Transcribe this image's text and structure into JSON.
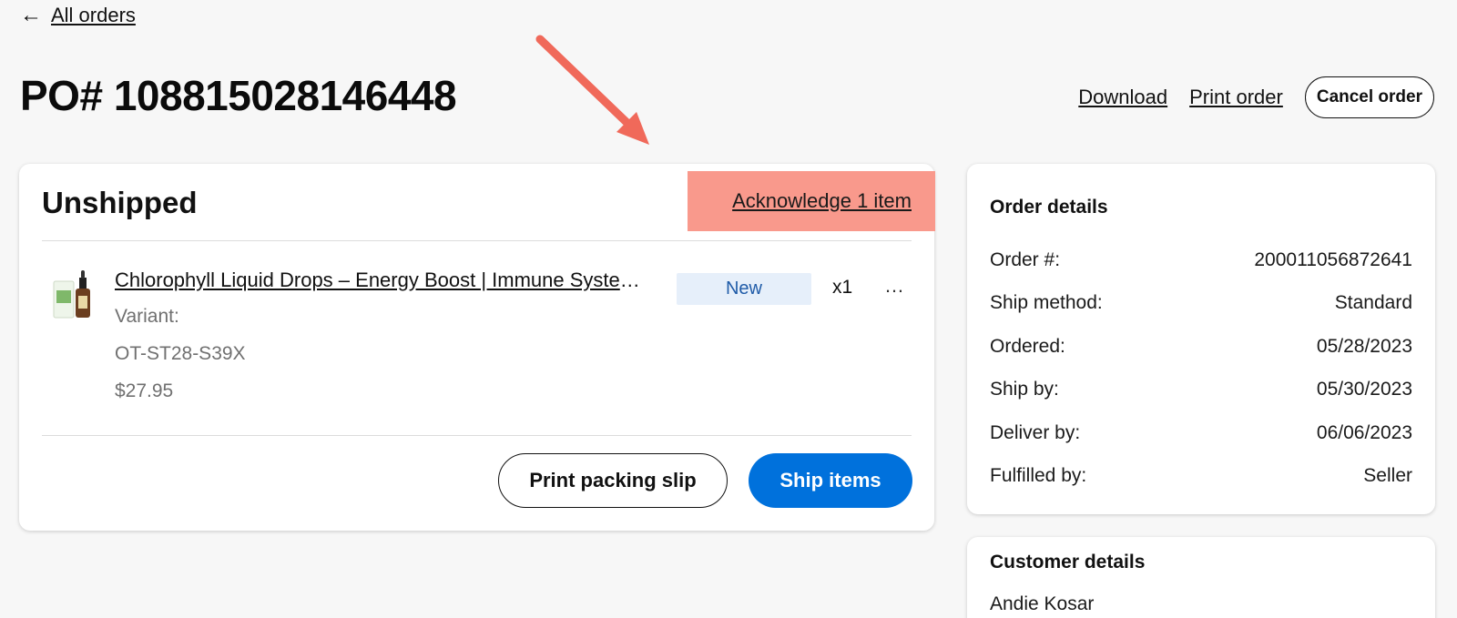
{
  "nav": {
    "back_label": "All orders",
    "back_arrow": "←"
  },
  "page": {
    "title": "PO# 108815028146448"
  },
  "header_actions": {
    "download": "Download",
    "print_order": "Print order",
    "cancel_order": "Cancel order"
  },
  "annotation": {
    "color": "#f0695a",
    "highlight_color": "#f9998c"
  },
  "unshipped": {
    "title": "Unshipped",
    "acknowledge_label": "Acknowledge 1 item",
    "item": {
      "name": "Chlorophyll Liquid Drops – Energy Boost | Immune System Support",
      "variant_label": "Variant:",
      "sku": "OT-ST28-S39X",
      "price": "$27.95",
      "status": "New",
      "quantity": "x1",
      "more_icon": "…"
    },
    "print_slip_label": "Print packing slip",
    "ship_items_label": "Ship items"
  },
  "order_details": {
    "title": "Order details",
    "rows": [
      {
        "label": "Order #:",
        "value": "200011056872641"
      },
      {
        "label": "Ship method:",
        "value": "Standard"
      },
      {
        "label": "Ordered:",
        "value": "05/28/2023"
      },
      {
        "label": "Ship by:",
        "value": "05/30/2023"
      },
      {
        "label": "Deliver by:",
        "value": "06/06/2023"
      },
      {
        "label": "Fulfilled by:",
        "value": "Seller"
      }
    ]
  },
  "customer_details": {
    "title": "Customer details",
    "name": "Andie Kosar"
  },
  "colors": {
    "primary": "#0071dc",
    "badge_bg": "#e6effa",
    "badge_text": "#1f5ba8"
  }
}
